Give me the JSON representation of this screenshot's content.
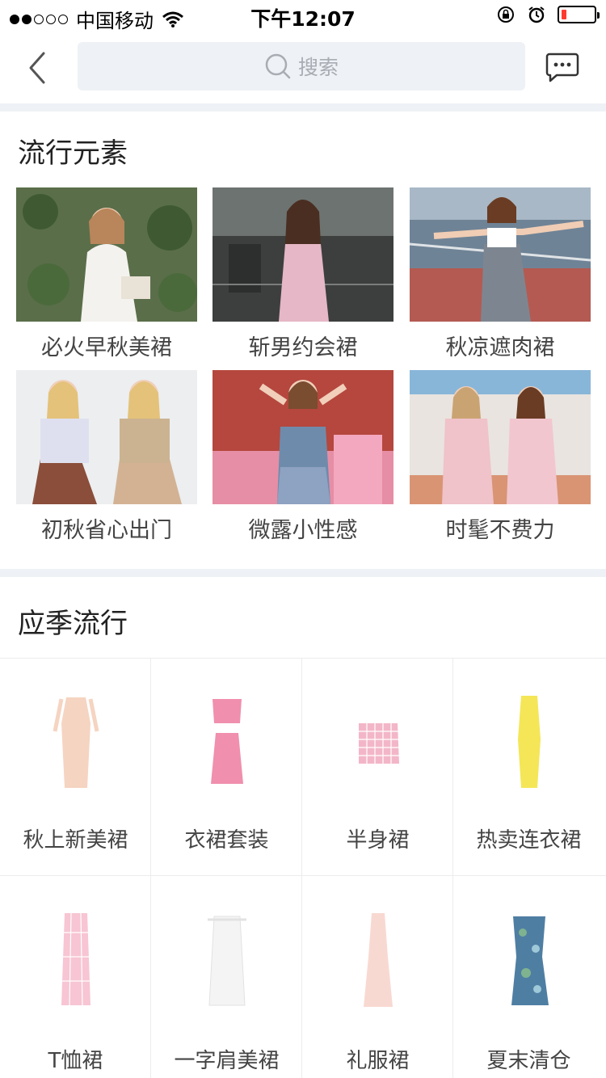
{
  "status_bar": {
    "carrier": "中国移动",
    "time": "下午12:07",
    "battery_level": 0.15
  },
  "nav": {
    "search_placeholder": "搜索",
    "back_icon": "chevron-left-icon",
    "message_icon": "chat-bubble-icon"
  },
  "trend_section": {
    "title": "流行元素",
    "items": [
      {
        "label": "必火早秋美裙"
      },
      {
        "label": "斩男约会裙"
      },
      {
        "label": "秋凉遮肉裙"
      },
      {
        "label": "初秋省心出门"
      },
      {
        "label": "微露小性感"
      },
      {
        "label": "时髦不费力"
      }
    ]
  },
  "season_section": {
    "title": "应季流行",
    "items": [
      {
        "label": "秋上新美裙"
      },
      {
        "label": "衣裙套装"
      },
      {
        "label": "半身裙"
      },
      {
        "label": "热卖连衣裙"
      },
      {
        "label": "T恤裙"
      },
      {
        "label": "一字肩美裙"
      },
      {
        "label": "礼服裙"
      },
      {
        "label": "夏末清仓"
      }
    ]
  },
  "colors": {
    "background": "#ffffff",
    "separator": "#eef1f5",
    "search_bg": "#eef1f5",
    "battery_low": "#ff3b30"
  }
}
